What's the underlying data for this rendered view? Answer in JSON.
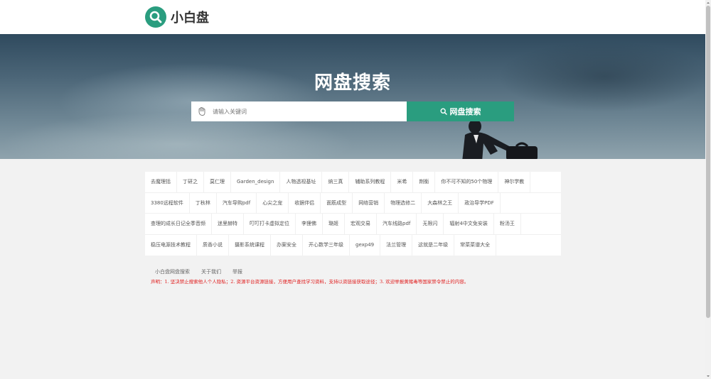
{
  "header": {
    "logo_text": "小白盘"
  },
  "hero": {
    "title": "网盘搜索",
    "search_placeholder": "请输入关键词",
    "search_button": "网盘搜索"
  },
  "tags": [
    [
      "去魔理括",
      "丁研之",
      "莫仁理",
      "Garden_design",
      "人物透视基址",
      "纳三真",
      "辅助系列教程",
      "米希",
      "荆衡",
      "你不可不知的50个物理",
      "神尔学教"
    ],
    [
      "3380远程软件",
      "丁秋林",
      "汽车导购pdf",
      "心尖之宠",
      "收据伴侣",
      "面筋成型",
      "网络营销",
      "物理选修二",
      "大森林之王",
      "政治导学PDF"
    ],
    [
      "查理的成长日记全季音频",
      "迷里赫特",
      "叮叮打卡虚拟定位",
      "李狸佛",
      "璐姬",
      "宏观交易",
      "汽车线路pdf",
      "无限闪",
      "辐射4中文免安装",
      "粉汤王"
    ],
    [
      "稳压电源技术教程",
      "质香小说",
      "摄影系统课程",
      "办案安全",
      "开心数学三年级",
      "gexp49",
      "法兰管理",
      "这就是二年级",
      "常菜菜谱大全"
    ]
  ],
  "footer": {
    "links": [
      "小白盘网盘搜索",
      "关于我们",
      "举报"
    ],
    "notice": "声明：1. 坚决禁止搜索他人个人隐私；2. 资源平台资源链接，方便用户查找学习资料，支持以资链接获取途径；3. 欢迎举报黄赌毒等国家禁令禁止的内容。"
  },
  "colors": {
    "accent": "#2a9d7f",
    "notice": "#e02020"
  }
}
